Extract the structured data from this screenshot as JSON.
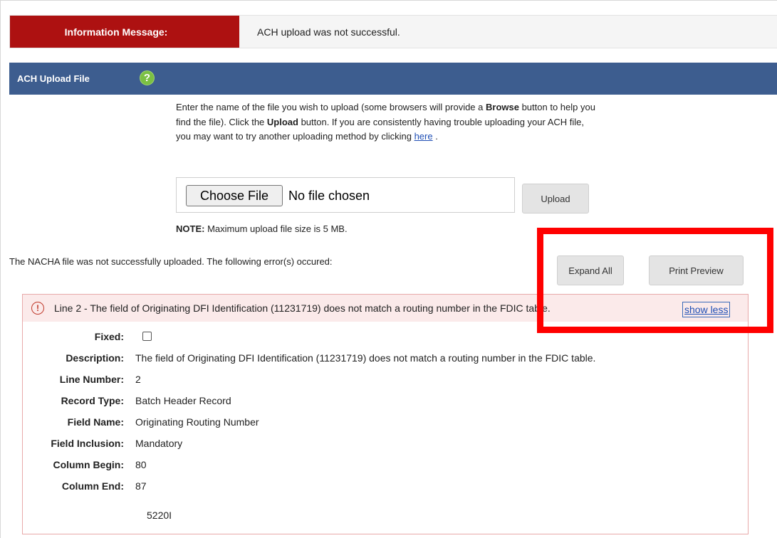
{
  "info": {
    "label": "Information Message:",
    "text": "ACH upload was not successful."
  },
  "section": {
    "title": "ACH Upload File",
    "help_icon": "?"
  },
  "instructions": {
    "part1": "Enter the name of the file you wish to upload (some browsers will provide a ",
    "browse": "Browse",
    "part2": " button to help you find the file). Click the ",
    "upload": "Upload",
    "part3": " button. If you are consistently having trouble uploading your ACH file, you may want to try another uploading method by clicking ",
    "link": "here",
    "part4": " ."
  },
  "file_input": {
    "choose_label": "Choose File",
    "status": "No file chosen"
  },
  "upload_button": "Upload",
  "note": {
    "label": "NOTE:",
    "text": " Maximum upload file size is 5 MB."
  },
  "error_intro": "The NACHA file was not successfully uploaded. The following error(s) occured:",
  "buttons": {
    "expand_all": "Expand All",
    "print_preview": "Print Preview"
  },
  "error": {
    "icon": "!",
    "header": "Line 2 - The field of Originating DFI Identification (11231719) does not match a routing number in the FDIC table.",
    "toggle": "show less",
    "details": [
      {
        "label": "Fixed:",
        "value": ""
      },
      {
        "label": "Description:",
        "value": "The field of Originating DFI Identification (11231719) does not match a routing number in the FDIC table."
      },
      {
        "label": "Line Number:",
        "value": "2"
      },
      {
        "label": "Record Type:",
        "value": "Batch Header Record"
      },
      {
        "label": "Field Name:",
        "value": "Originating Routing Number"
      },
      {
        "label": "Field Inclusion:",
        "value": "Mandatory"
      },
      {
        "label": "Column Begin:",
        "value": "80"
      },
      {
        "label": "Column End:",
        "value": "87"
      }
    ],
    "partial_text": "5220I"
  }
}
